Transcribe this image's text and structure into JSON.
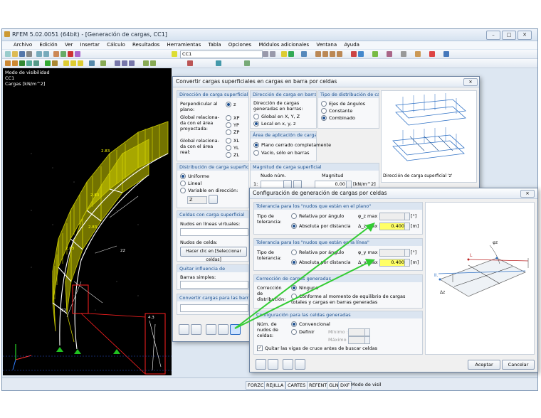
{
  "window": {
    "title": "RFEM 5.02.0051 (64bit) - [Generación de cargas, CC1]"
  },
  "menu": [
    "Archivo",
    "Edición",
    "Ver",
    "Insertar",
    "Cálculo",
    "Resultados",
    "Herramientas",
    "Tabla",
    "Opciones",
    "Módulos adicionales",
    "Ventana",
    "Ayuda"
  ],
  "toolbar": {
    "loadcase": "CC1"
  },
  "viewport": {
    "info": "Modo de visibilidad\nCC1\nCargas [kN/m^2]",
    "labels": [
      "2.83",
      "2.83",
      "2.83",
      "2.83",
      "22",
      "22",
      "4.3"
    ]
  },
  "statusbar": {
    "items": [
      "FORZC",
      "REJILLA",
      "CARTES",
      "REFENT",
      "GLN",
      "DXF",
      "Modo de visil"
    ]
  },
  "dialog1": {
    "title": "Convertir cargas superficiales en cargas en barra por celdas",
    "g_dir_surface": {
      "head": "Dirección de carga superficial",
      "perp": "Perpendicular al plano:",
      "proj": "Global relaciona-da con el área proyectada:",
      "real": "Global relaciona-da con el área real:",
      "z": "z",
      "xp": "XP",
      "yp": "YP",
      "zp": "ZP",
      "xl": "XL",
      "yl": "YL",
      "zl": "ZL"
    },
    "g_dir_bar": {
      "head": "Dirección de carga en barra",
      "text": "Dirección de cargas generadas en barras:",
      "global": "Global en X, Y, Z",
      "local": "Local en x, y, z"
    },
    "g_dist_type": {
      "head": "Tipo de distribución de carga",
      "steps": "Ejes de ángulos",
      "const": "Constante",
      "comb": "Combinado"
    },
    "g_area": {
      "head": "Área de aplicación de carga",
      "closed": "Plano cerrado completamente",
      "empty": "Vacío, sólo en barras"
    },
    "g_surface_dist": {
      "head": "Distribución de carga superficial",
      "uniform": "Uniforme",
      "linear": "Lineal",
      "variable": "Variable en dirección:",
      "axis": "Z"
    },
    "g_magnitude": {
      "head": "Magnitud de carga superficial",
      "node": "Nudo núm.",
      "mag": "Magnitud",
      "row": "1:",
      "value": "0.00",
      "unit": "[kN/m^2]"
    },
    "g_cells": {
      "head": "Celdas con carga superficial",
      "nodes_virtual": "Nudos en líneas virtuales:",
      "cell_nodes": "Nudos de celda:",
      "pick": "Hacer clic en [Seleccionar celdas]"
    },
    "g_remove": {
      "head": "Quitar influencia de",
      "bars": "Barras simples:"
    },
    "g_convert": {
      "head": "Convertir cargas para las barras nú"
    },
    "preview_caption": "Dirección de carga superficial 'z'"
  },
  "dialog2": {
    "title": "Configuración de generación de cargas por celdas",
    "g_tol_plane": {
      "head": "Tolerancia para los \"nudos que están en el plano\"",
      "type": "Tipo de tolerancia:",
      "rel": "Relativa por ángulo",
      "abs": "Absoluta por distancia",
      "phi": "φ_z max :",
      "delta": "Δ_z max :",
      "delta_val": "0.400",
      "unit_deg": "[°]",
      "unit_m": "[m]"
    },
    "g_tol_line": {
      "head": "Tolerancia para los \"nudos que están en la línea\"",
      "type": "Tipo de tolerancia:",
      "rel": "Relativa por ángulo",
      "abs": "Absoluta por distancia",
      "phi": "φ_y max :",
      "delta": "Δ_y max :",
      "delta_val": "0.400",
      "unit_deg": "[°]",
      "unit_m": "[m]"
    },
    "g_correction": {
      "head": "Corrección de cargas generadas",
      "label": "Corrección de distribución:",
      "none": "Ninguna",
      "conform": "Conforme al momento de equilibrio de cargas totales y cargas en barras generadas"
    },
    "g_config": {
      "head": "Configuración para las celdas generadas",
      "label": "Núm. de nudos de celdas:",
      "conv": "Convencional",
      "define": "Definir",
      "min": "Mínimo :",
      "max": "Máximo :",
      "check": "Quitar las vigas de cruce antes de buscar celdas"
    },
    "buttons": {
      "ok": "Aceptar",
      "cancel": "Cancelar"
    },
    "diagram": {
      "phi": "φz",
      "delta": "Δz",
      "l": "L",
      "ii": "II."
    }
  },
  "colors": {
    "accent": "#1a4f8f",
    "highlight": "#ffff66",
    "load": "#d8d800",
    "arrow": "#33cc33"
  }
}
